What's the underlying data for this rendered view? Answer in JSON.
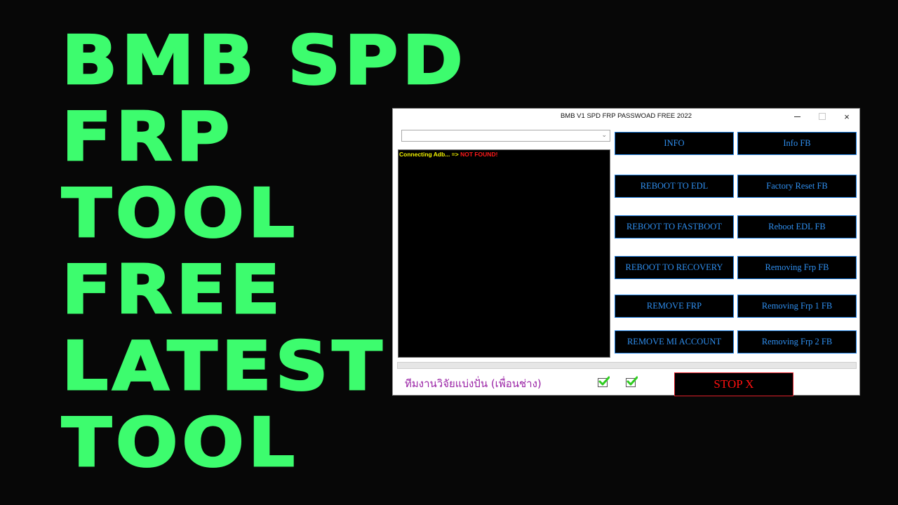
{
  "headline": {
    "lines": [
      "BMB SPD",
      "FRP",
      "TOOL",
      "FREE",
      "LATEST",
      "TOOL"
    ],
    "color": "#3dfc6e"
  },
  "window": {
    "title": "BMB V1 SPD FRP PASSWOAD FREE 2022",
    "controls": {
      "minimize": "minimize-icon",
      "maximize": "maximize-icon",
      "close": "×"
    },
    "port_select": {
      "value": "",
      "arrow": "⌄"
    },
    "console": {
      "lines": [
        {
          "status": "Connecting Adb... ",
          "arrow": "=> ",
          "result": "NOT FOUND!"
        }
      ],
      "colors": {
        "status": "#f4f400",
        "result": "#ff1a1a"
      }
    },
    "buttons_left": [
      "INFO",
      "REBOOT TO EDL",
      "REBOOT TO FASTBOOT",
      "REBOOT TO RECOVERY",
      "REMOVE FRP",
      "REMOVE MI ACCOUNT"
    ],
    "buttons_right": [
      "Info FB",
      "Factory Reset FB",
      "Reboot EDL FB",
      "Removing Frp  FB",
      "Removing Frp 1 FB",
      "Removing Frp 2 FB"
    ],
    "button_color": "#2f8ff0",
    "progress": {
      "percent": 0
    },
    "footer": {
      "label": "ทีมงานวิจัยแบ่งปั่น (เพื่อนช่าง)",
      "checkbox1_checked": true,
      "checkbox2_checked": true,
      "stop_label": "STOP X",
      "stop_color": "#ff1010"
    }
  }
}
